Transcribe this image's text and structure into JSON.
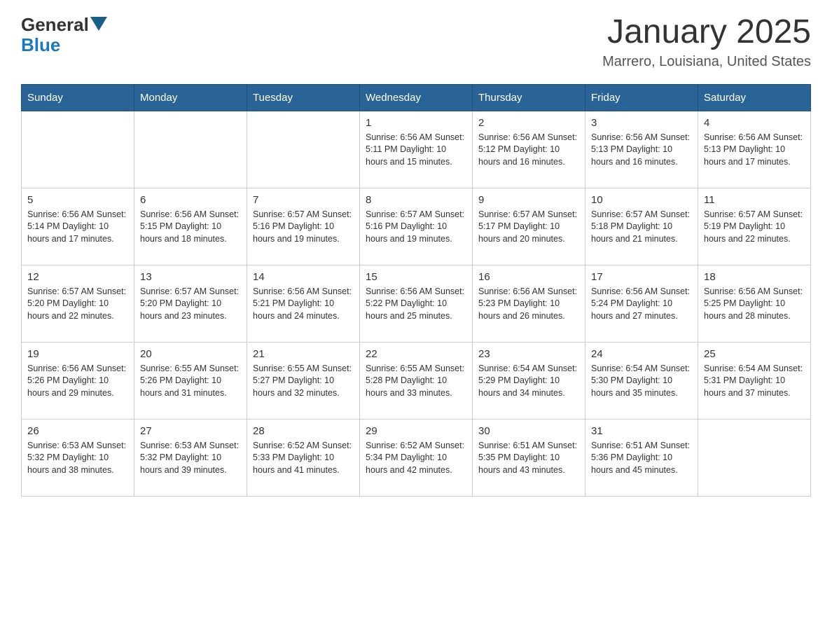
{
  "header": {
    "logo_general": "General",
    "logo_blue": "Blue",
    "title": "January 2025",
    "subtitle": "Marrero, Louisiana, United States"
  },
  "calendar": {
    "days_of_week": [
      "Sunday",
      "Monday",
      "Tuesday",
      "Wednesday",
      "Thursday",
      "Friday",
      "Saturday"
    ],
    "weeks": [
      [
        {
          "day": "",
          "info": ""
        },
        {
          "day": "",
          "info": ""
        },
        {
          "day": "",
          "info": ""
        },
        {
          "day": "1",
          "info": "Sunrise: 6:56 AM\nSunset: 5:11 PM\nDaylight: 10 hours\nand 15 minutes."
        },
        {
          "day": "2",
          "info": "Sunrise: 6:56 AM\nSunset: 5:12 PM\nDaylight: 10 hours\nand 16 minutes."
        },
        {
          "day": "3",
          "info": "Sunrise: 6:56 AM\nSunset: 5:13 PM\nDaylight: 10 hours\nand 16 minutes."
        },
        {
          "day": "4",
          "info": "Sunrise: 6:56 AM\nSunset: 5:13 PM\nDaylight: 10 hours\nand 17 minutes."
        }
      ],
      [
        {
          "day": "5",
          "info": "Sunrise: 6:56 AM\nSunset: 5:14 PM\nDaylight: 10 hours\nand 17 minutes."
        },
        {
          "day": "6",
          "info": "Sunrise: 6:56 AM\nSunset: 5:15 PM\nDaylight: 10 hours\nand 18 minutes."
        },
        {
          "day": "7",
          "info": "Sunrise: 6:57 AM\nSunset: 5:16 PM\nDaylight: 10 hours\nand 19 minutes."
        },
        {
          "day": "8",
          "info": "Sunrise: 6:57 AM\nSunset: 5:16 PM\nDaylight: 10 hours\nand 19 minutes."
        },
        {
          "day": "9",
          "info": "Sunrise: 6:57 AM\nSunset: 5:17 PM\nDaylight: 10 hours\nand 20 minutes."
        },
        {
          "day": "10",
          "info": "Sunrise: 6:57 AM\nSunset: 5:18 PM\nDaylight: 10 hours\nand 21 minutes."
        },
        {
          "day": "11",
          "info": "Sunrise: 6:57 AM\nSunset: 5:19 PM\nDaylight: 10 hours\nand 22 minutes."
        }
      ],
      [
        {
          "day": "12",
          "info": "Sunrise: 6:57 AM\nSunset: 5:20 PM\nDaylight: 10 hours\nand 22 minutes."
        },
        {
          "day": "13",
          "info": "Sunrise: 6:57 AM\nSunset: 5:20 PM\nDaylight: 10 hours\nand 23 minutes."
        },
        {
          "day": "14",
          "info": "Sunrise: 6:56 AM\nSunset: 5:21 PM\nDaylight: 10 hours\nand 24 minutes."
        },
        {
          "day": "15",
          "info": "Sunrise: 6:56 AM\nSunset: 5:22 PM\nDaylight: 10 hours\nand 25 minutes."
        },
        {
          "day": "16",
          "info": "Sunrise: 6:56 AM\nSunset: 5:23 PM\nDaylight: 10 hours\nand 26 minutes."
        },
        {
          "day": "17",
          "info": "Sunrise: 6:56 AM\nSunset: 5:24 PM\nDaylight: 10 hours\nand 27 minutes."
        },
        {
          "day": "18",
          "info": "Sunrise: 6:56 AM\nSunset: 5:25 PM\nDaylight: 10 hours\nand 28 minutes."
        }
      ],
      [
        {
          "day": "19",
          "info": "Sunrise: 6:56 AM\nSunset: 5:26 PM\nDaylight: 10 hours\nand 29 minutes."
        },
        {
          "day": "20",
          "info": "Sunrise: 6:55 AM\nSunset: 5:26 PM\nDaylight: 10 hours\nand 31 minutes."
        },
        {
          "day": "21",
          "info": "Sunrise: 6:55 AM\nSunset: 5:27 PM\nDaylight: 10 hours\nand 32 minutes."
        },
        {
          "day": "22",
          "info": "Sunrise: 6:55 AM\nSunset: 5:28 PM\nDaylight: 10 hours\nand 33 minutes."
        },
        {
          "day": "23",
          "info": "Sunrise: 6:54 AM\nSunset: 5:29 PM\nDaylight: 10 hours\nand 34 minutes."
        },
        {
          "day": "24",
          "info": "Sunrise: 6:54 AM\nSunset: 5:30 PM\nDaylight: 10 hours\nand 35 minutes."
        },
        {
          "day": "25",
          "info": "Sunrise: 6:54 AM\nSunset: 5:31 PM\nDaylight: 10 hours\nand 37 minutes."
        }
      ],
      [
        {
          "day": "26",
          "info": "Sunrise: 6:53 AM\nSunset: 5:32 PM\nDaylight: 10 hours\nand 38 minutes."
        },
        {
          "day": "27",
          "info": "Sunrise: 6:53 AM\nSunset: 5:32 PM\nDaylight: 10 hours\nand 39 minutes."
        },
        {
          "day": "28",
          "info": "Sunrise: 6:52 AM\nSunset: 5:33 PM\nDaylight: 10 hours\nand 41 minutes."
        },
        {
          "day": "29",
          "info": "Sunrise: 6:52 AM\nSunset: 5:34 PM\nDaylight: 10 hours\nand 42 minutes."
        },
        {
          "day": "30",
          "info": "Sunrise: 6:51 AM\nSunset: 5:35 PM\nDaylight: 10 hours\nand 43 minutes."
        },
        {
          "day": "31",
          "info": "Sunrise: 6:51 AM\nSunset: 5:36 PM\nDaylight: 10 hours\nand 45 minutes."
        },
        {
          "day": "",
          "info": ""
        }
      ]
    ]
  }
}
